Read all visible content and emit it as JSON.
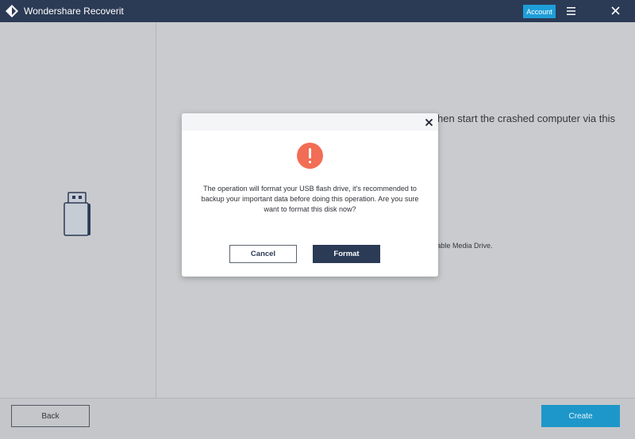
{
  "window": {
    "title": "Wondershare Recoverit",
    "account_label": "Account",
    "logo_icon": "recoverit-logo-icon",
    "menu_icon": "hamburger-menu-icon",
    "close_icon": "close-icon"
  },
  "left_panel": {
    "device_icon": "usb-drive-icon"
  },
  "background": {
    "instruction_fragment": "hen start the crashed computer via this",
    "media_fragment": "table Media Drive."
  },
  "dialog": {
    "close_icon": "close-icon",
    "warning_icon": "exclamation-circle-icon",
    "warning_color": "#f26d55",
    "message": "The operation will format your USB flash drive, it's recommended to backup your important data before doing this operation. Are you sure want to format this disk now?",
    "cancel_label": "Cancel",
    "format_label": "Format"
  },
  "footer": {
    "back_label": "Back",
    "create_label": "Create"
  },
  "colors": {
    "titlebar": "#2b3a55",
    "accent": "#1d9ed8",
    "primary_button": "#2b3a55"
  }
}
